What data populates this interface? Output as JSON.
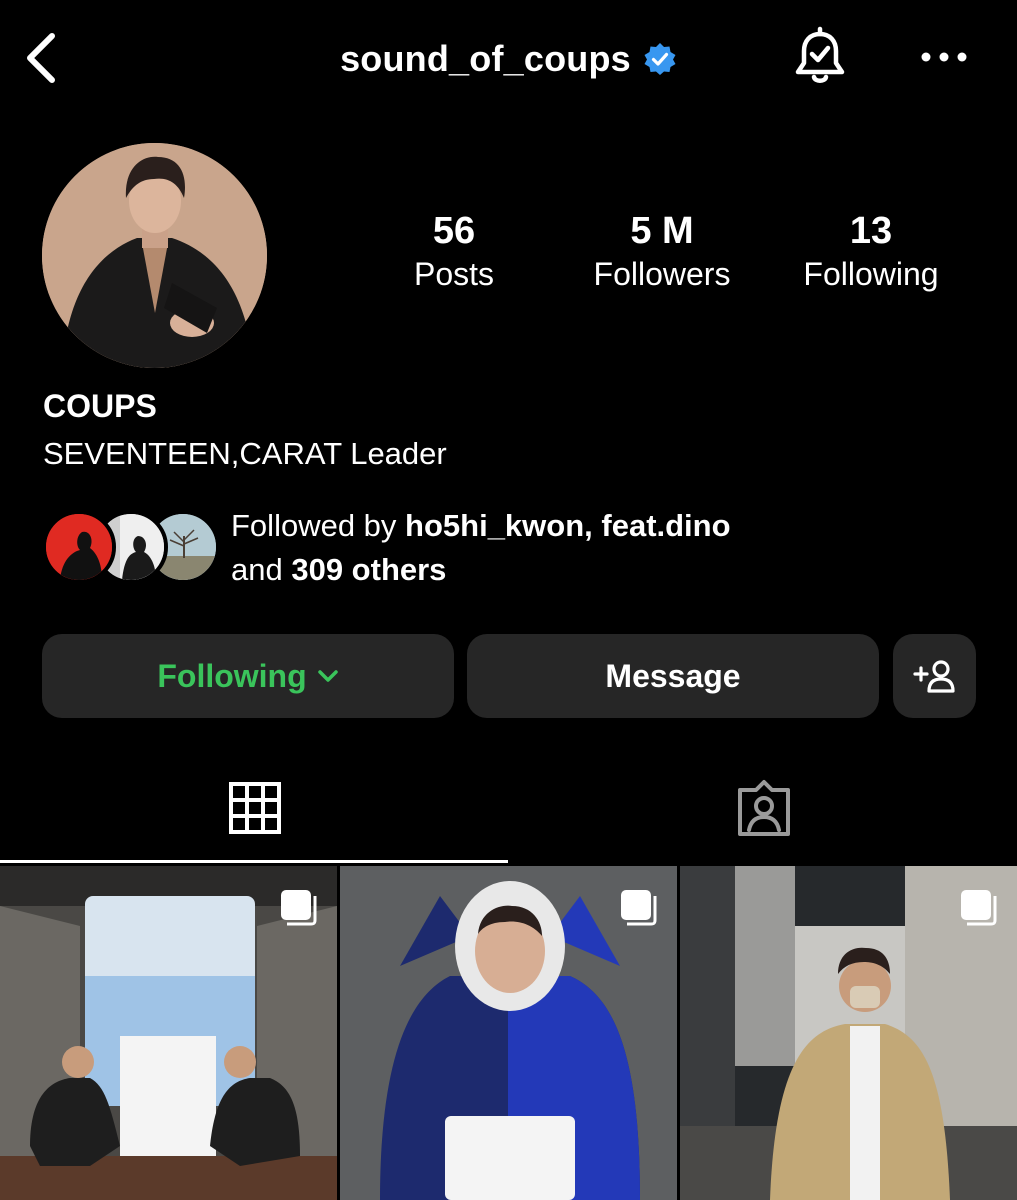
{
  "header": {
    "username": "sound_of_coups",
    "verified": true
  },
  "profile": {
    "display_name": "COUPS",
    "bio": "SEVENTEEN,CARAT Leader",
    "stats": [
      {
        "value": "56",
        "label": "Posts"
      },
      {
        "value": "5 M",
        "label": "Followers"
      },
      {
        "value": "13",
        "label": "Following"
      }
    ]
  },
  "followed_by": {
    "prefix": "Followed by ",
    "users": "ho5hi_kwon, feat.dino",
    "and_text": "and ",
    "others": "309 others"
  },
  "actions": {
    "following_label": "Following",
    "message_label": "Message"
  },
  "colors": {
    "accent_green": "#3ac45b",
    "button_bg": "#262626",
    "verified_blue": "#3897f0"
  },
  "tabs": [
    {
      "icon": "grid-icon",
      "active": true
    },
    {
      "icon": "tagged-icon",
      "active": false
    }
  ],
  "posts": [
    {
      "icon": "multiple-photos-icon"
    },
    {
      "icon": "multiple-photos-icon"
    },
    {
      "icon": "multiple-photos-icon"
    }
  ]
}
